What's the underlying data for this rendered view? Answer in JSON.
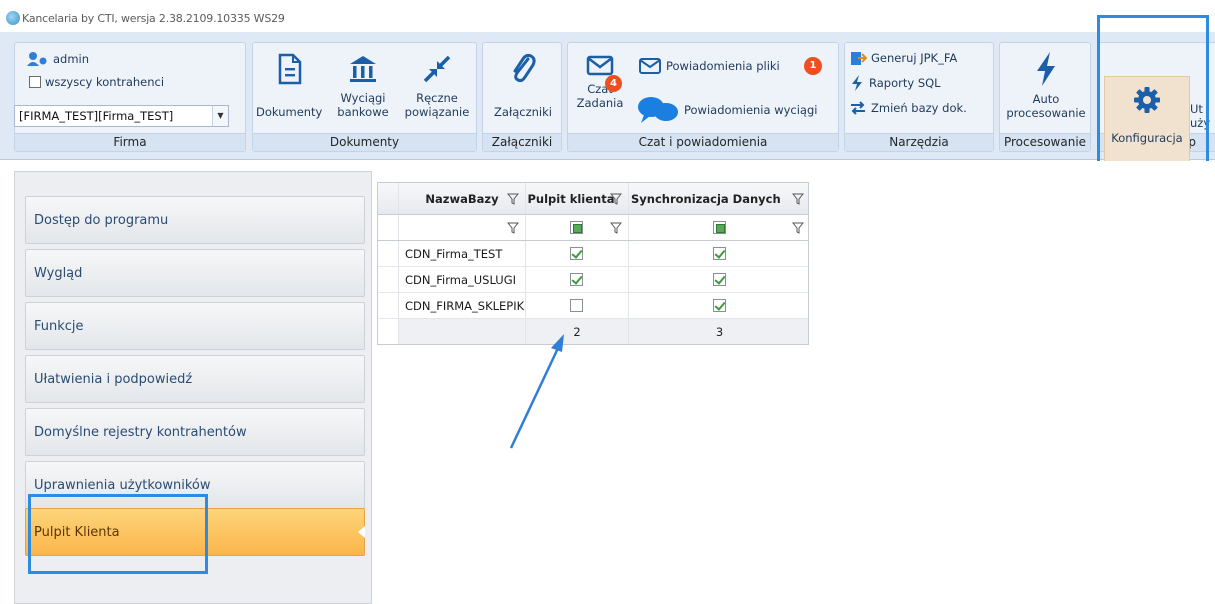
{
  "window": {
    "title": "Kancelaria by CTI, wersja  2.38.2109.10335 WS29"
  },
  "ribbon": {
    "firma": {
      "user": "admin",
      "all_contractors": "wszyscy kontrahenci",
      "company_value": "[FIRMA_TEST][Firma_TEST]",
      "group_label": "Firma"
    },
    "dokumenty": {
      "btn_dokumenty": "Dokumenty",
      "btn_wyciagi_line1": "Wyciągi",
      "btn_wyciagi_line2": "bankowe",
      "btn_reczne_line1": "Ręczne",
      "btn_reczne_line2": "powiązanie",
      "group_label": "Dokumenty"
    },
    "zalaczniki": {
      "btn": "Załączniki",
      "group_label": "Załączniki"
    },
    "czat": {
      "btn_czat": "Czat",
      "btn_zadania": "Zadania",
      "zadania_badge": "4",
      "powiadomienia_pliki": "Powiadomienia pliki",
      "pliki_badge": "1",
      "powiadomienia_wyciagi": "Powiadomienia wyciągi",
      "group_label": "Czat i powiadomienia"
    },
    "narzedzia": {
      "generuj": "Generuj JPK_FA",
      "raporty": "Raporty SQL",
      "zmien": "Zmień bazy dok.",
      "group_label": "Narzędzia"
    },
    "procesowanie": {
      "btn_line1": "Auto",
      "btn_line2": "procesowanie",
      "group_label": "Procesowanie"
    },
    "konfiguracja": {
      "btn": "Konfiguracja",
      "btn2_line1": "Ut",
      "btn2_line2": "uży",
      "group_label": "Konfiguracja p"
    }
  },
  "sidebar": {
    "items": [
      {
        "label": "Dostęp do programu"
      },
      {
        "label": "Wygląd"
      },
      {
        "label": "Funkcje"
      },
      {
        "label": "Ułatwienia i podpowiedź"
      },
      {
        "label": "Domyślne rejestry kontrahentów"
      },
      {
        "label": "Uprawnienia użytkowników"
      },
      {
        "label": "Pulpit Klienta"
      }
    ],
    "active_index": 6
  },
  "grid": {
    "columns": [
      "NazwaBazy",
      "Pulpit klienta",
      "Synchronizacja Danych"
    ],
    "rows": [
      {
        "name": "CDN_Firma_TEST",
        "pulpit": true,
        "sync": true
      },
      {
        "name": "CDN_Firma_USLUGI",
        "pulpit": true,
        "sync": true
      },
      {
        "name": "CDN_FIRMA_SKLEPIK",
        "pulpit": false,
        "sync": true
      }
    ],
    "footer": {
      "pulpit": "2",
      "sync": "3"
    }
  },
  "colors": {
    "accent": "#2f8be0",
    "active_nav": "#fbb54a",
    "badge": "#ef4e1f"
  }
}
